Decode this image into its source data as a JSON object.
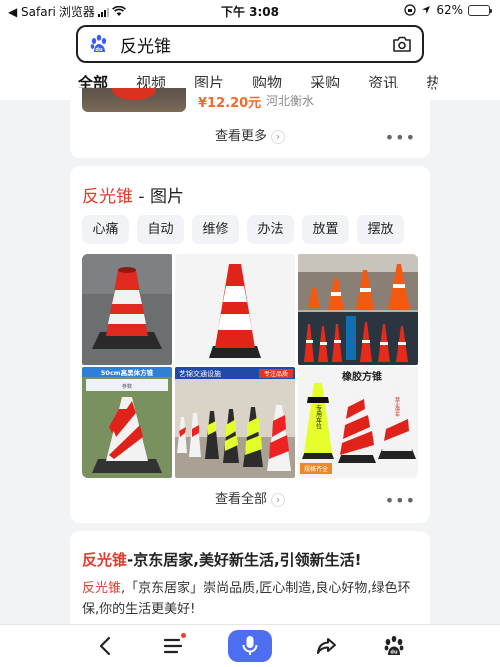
{
  "status_bar": {
    "back_app": "◀ Safari",
    "carrier": "浏览器",
    "time": "下午 3:08",
    "battery": "62%",
    "battery_level": 0.62
  },
  "search": {
    "query": "反光锥",
    "logo_icon": "baidu-paw-icon",
    "camera_icon": "camera-icon"
  },
  "tabs": [
    {
      "label": "全部",
      "active": true
    },
    {
      "label": "视频"
    },
    {
      "label": "图片"
    },
    {
      "label": "购物"
    },
    {
      "label": "采购"
    },
    {
      "label": "资讯"
    },
    {
      "label": "热议"
    }
  ],
  "shopping_card": {
    "price": "¥12.20元",
    "location": "河北衡水",
    "more_label": "查看更多"
  },
  "images_card": {
    "title_highlight": "反光锥",
    "title_rest": " - 图片",
    "chips": [
      "心痛",
      "自动",
      "维修",
      "办法",
      "放置",
      "摆放"
    ],
    "images": [
      {
        "icon": "traffic-cone-photo"
      },
      {
        "icon": "traffic-cone-photo"
      },
      {
        "icon": "traffic-cone-group-photo"
      },
      {
        "icon": "traffic-cone-photo",
        "caption": "50cm高黑体方锥",
        "sub": "参数"
      },
      {
        "icon": "traffic-cone-row-photo",
        "caption": "艺锦交通设施",
        "tag": "专注品质"
      },
      {
        "icon": "rubber-cone-photo",
        "caption": "橡胶方锥",
        "cone_text": "专用车位",
        "cone_text2": "禁止停车",
        "tag": "规格齐全"
      }
    ],
    "more_label": "查看全部"
  },
  "result_card": {
    "title_highlight": "反光锥",
    "title_rest": "-京东居家,美好新生活,引领新生活!",
    "desc_highlight": "反光锥",
    "desc_rest": ",「京东居家」崇尚品质,匠心制造,良心好物,绿色环保,你的生活更美好!"
  },
  "bottom_nav": {
    "items": [
      "back-icon",
      "menu-icon",
      "microphone-icon",
      "share-icon",
      "baidu-paw-icon"
    ]
  },
  "colors": {
    "accent_blue": "#4e6ef2",
    "highlight_red": "#e23b2e",
    "price_orange": "#f06a2a"
  }
}
